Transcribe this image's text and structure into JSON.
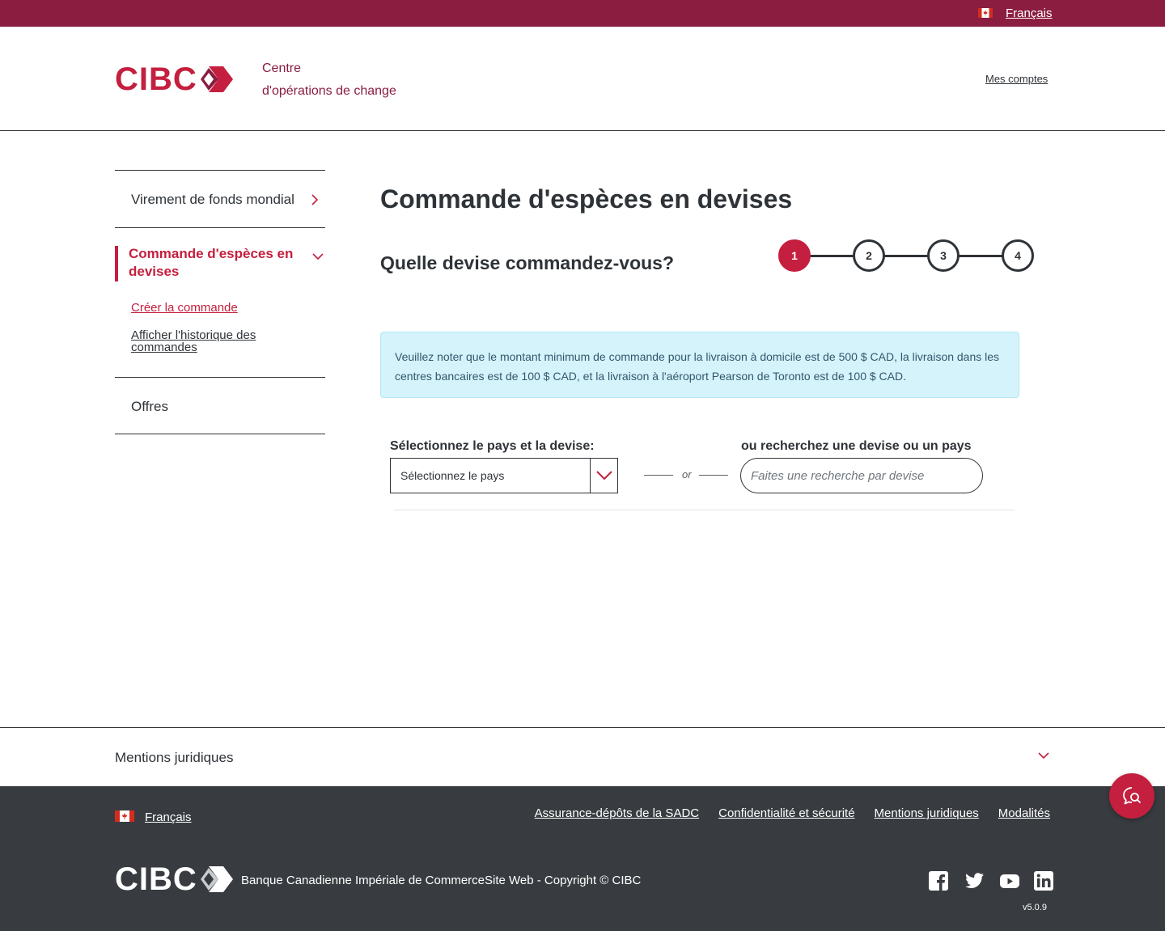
{
  "topbar": {
    "language_link": "Français"
  },
  "header": {
    "logo_text": "CIBC",
    "site_title_line1": "Centre",
    "site_title_line2": "d'opérations de change",
    "accounts_link": "Mes comptes"
  },
  "sidebar": {
    "items": [
      {
        "label": "Virement de fonds mondial"
      },
      {
        "label": "Commande d'espèces en devises",
        "expanded": true,
        "children": [
          {
            "label": "Créer la commande",
            "active": true
          },
          {
            "label": "Afficher l'historique des commandes"
          }
        ]
      },
      {
        "label": "Offres"
      }
    ]
  },
  "main": {
    "title": "Commande d'espèces en devises",
    "question": "Quelle devise commandez-vous?",
    "steps": [
      {
        "label": "1",
        "active": true
      },
      {
        "label": "2",
        "active": false
      },
      {
        "label": "3",
        "active": false
      },
      {
        "label": "4",
        "active": false
      }
    ],
    "notice": "Veuillez noter que le montant minimum de commande pour la livraison à domicile est de 500 $ CAD, la livraison dans les centres bancaires est de 100 $ CAD, et la livraison à l'aéroport Pearson de Toronto est de 100 $ CAD.",
    "select_label": "Sélectionnez le pays et la devise:",
    "select_value": "Sélectionnez le pays",
    "or_text": "or",
    "search_label": "ou recherchez une devise ou un pays",
    "search_placeholder": "Faites une recherche par devise"
  },
  "legal": {
    "title": "Mentions juridiques"
  },
  "footer": {
    "language_link": "Français",
    "links": [
      "Assurance-dépôts de la SADC",
      "Confidentialité et sécurité",
      "Mentions juridiques",
      "Modalités"
    ],
    "logo_text": "CIBC",
    "copyright": "Banque Canadienne Impériale de CommerceSite Web - Copyright © CIBC",
    "social_icons": [
      "facebook-icon",
      "twitter-icon",
      "youtube-icon",
      "linkedin-icon"
    ],
    "version": "v5.0.9"
  },
  "colors": {
    "brand_red": "#c41f3e",
    "brand_burgundy": "#8b1d41",
    "footer_bg": "#383c40",
    "notice_bg": "#d4f3fb",
    "text": "#2e3338"
  }
}
